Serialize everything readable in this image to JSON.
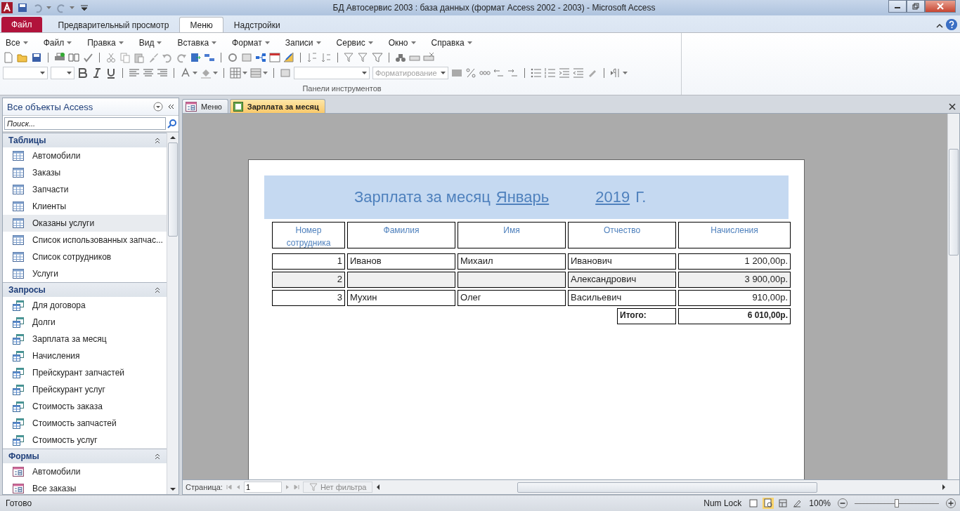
{
  "window": {
    "title": "БД Автосервис 2003 : база данных (формат Access 2002 - 2003)  -  Microsoft Access"
  },
  "file_tab": {
    "label": "Файл"
  },
  "tabs": [
    {
      "label": "Предварительный просмотр",
      "selected": false
    },
    {
      "label": "Меню",
      "selected": true
    },
    {
      "label": "Надстройки",
      "selected": false
    }
  ],
  "menu": [
    "Все",
    "Файл",
    "Правка",
    "Вид",
    "Вставка",
    "Формат",
    "Записи",
    "Сервис",
    "Окно",
    "Справка"
  ],
  "toolbar": {
    "style_field": {
      "placeholder": "Форматирование",
      "disabled": true
    },
    "group_label": "Панели инструментов"
  },
  "navigation": {
    "title": "Все объекты Access",
    "search": {
      "placeholder": "Поиск..."
    },
    "groups": [
      {
        "title": "Таблицы",
        "kind": "table",
        "items": [
          {
            "label": "Автомобили",
            "selected": false
          },
          {
            "label": "Заказы",
            "selected": false
          },
          {
            "label": "Запчасти",
            "selected": false
          },
          {
            "label": "Клиенты",
            "selected": false
          },
          {
            "label": "Оказаны услуги",
            "selected": true
          },
          {
            "label": "Список использованных запчас...",
            "selected": false
          },
          {
            "label": "Список сотрудников",
            "selected": false
          },
          {
            "label": "Услуги",
            "selected": false
          }
        ]
      },
      {
        "title": "Запросы",
        "kind": "query",
        "items": [
          {
            "label": "Для договора",
            "selected": false
          },
          {
            "label": "Долги",
            "selected": false
          },
          {
            "label": "Зарплата за месяц",
            "selected": false
          },
          {
            "label": "Начисления",
            "selected": false
          },
          {
            "label": "Прейскурант запчастей",
            "selected": false
          },
          {
            "label": "Прейскурант услуг",
            "selected": false
          },
          {
            "label": "Стоимость заказа",
            "selected": false
          },
          {
            "label": "Стоимость запчастей",
            "selected": false
          },
          {
            "label": "Стоимость услуг",
            "selected": false
          }
        ]
      },
      {
        "title": "Формы",
        "kind": "form",
        "items": [
          {
            "label": "Автомобили",
            "selected": false
          },
          {
            "label": "Все заказы",
            "selected": false
          }
        ]
      }
    ]
  },
  "document_tabs": [
    {
      "label": "Меню",
      "kind": "form",
      "selected": false
    },
    {
      "label": "Зарплата за месяц",
      "kind": "report",
      "selected": true
    }
  ],
  "report": {
    "title": "Зарплата за месяц",
    "month": "Январь",
    "year": "2019",
    "year_suffix": "Г.",
    "columns": [
      "Номер сотрудника",
      "Фамилия",
      "Имя",
      "Отчество",
      "Начисления"
    ],
    "rows": [
      {
        "number": "1",
        "surname": "Иванов",
        "name": "Михаил",
        "patronymic": "Иванович",
        "amount": "1 200,00р.",
        "shaded": false
      },
      {
        "number": "2",
        "patronymic": "Александрович",
        "amount": "3 900,00р.",
        "shaded": true
      },
      {
        "number": "3",
        "surname": "Мухин",
        "name": "Олег",
        "patronymic": "Васильевич",
        "amount": "910,00р.",
        "shaded": false
      }
    ],
    "total_label": "Итого:",
    "total": "6 010,00р."
  },
  "record_navigation": {
    "label": "Страница:",
    "page": "1",
    "filter": "Нет фильтра"
  },
  "status_bar": {
    "status": "Готово",
    "num_lock": "Num Lock",
    "zoom": "100%",
    "zoom_slider": {
      "level": 0.5
    }
  }
}
